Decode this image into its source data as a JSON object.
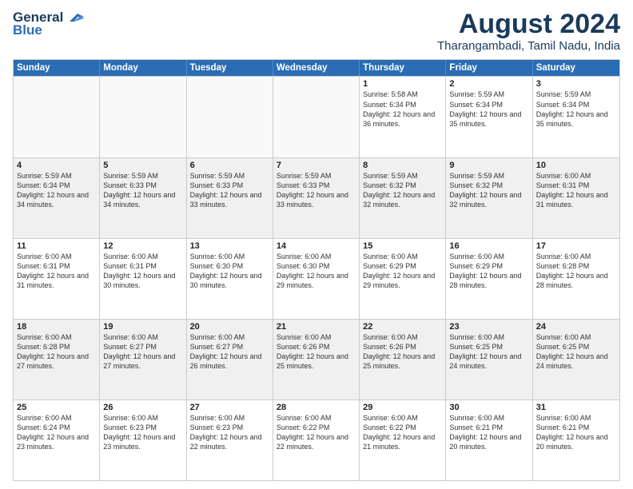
{
  "header": {
    "logo_line1": "General",
    "logo_line2": "Blue",
    "main_title": "August 2024",
    "subtitle": "Tharangambadi, Tamil Nadu, India"
  },
  "weekdays": [
    "Sunday",
    "Monday",
    "Tuesday",
    "Wednesday",
    "Thursday",
    "Friday",
    "Saturday"
  ],
  "weeks": [
    [
      {
        "day": "",
        "info": "",
        "empty": true
      },
      {
        "day": "",
        "info": "",
        "empty": true
      },
      {
        "day": "",
        "info": "",
        "empty": true
      },
      {
        "day": "",
        "info": "",
        "empty": true
      },
      {
        "day": "1",
        "info": "Sunrise: 5:58 AM\nSunset: 6:34 PM\nDaylight: 12 hours\nand 36 minutes.",
        "empty": false
      },
      {
        "day": "2",
        "info": "Sunrise: 5:59 AM\nSunset: 6:34 PM\nDaylight: 12 hours\nand 35 minutes.",
        "empty": false
      },
      {
        "day": "3",
        "info": "Sunrise: 5:59 AM\nSunset: 6:34 PM\nDaylight: 12 hours\nand 35 minutes.",
        "empty": false
      }
    ],
    [
      {
        "day": "4",
        "info": "Sunrise: 5:59 AM\nSunset: 6:34 PM\nDaylight: 12 hours\nand 34 minutes.",
        "empty": false
      },
      {
        "day": "5",
        "info": "Sunrise: 5:59 AM\nSunset: 6:33 PM\nDaylight: 12 hours\nand 34 minutes.",
        "empty": false
      },
      {
        "day": "6",
        "info": "Sunrise: 5:59 AM\nSunset: 6:33 PM\nDaylight: 12 hours\nand 33 minutes.",
        "empty": false
      },
      {
        "day": "7",
        "info": "Sunrise: 5:59 AM\nSunset: 6:33 PM\nDaylight: 12 hours\nand 33 minutes.",
        "empty": false
      },
      {
        "day": "8",
        "info": "Sunrise: 5:59 AM\nSunset: 6:32 PM\nDaylight: 12 hours\nand 32 minutes.",
        "empty": false
      },
      {
        "day": "9",
        "info": "Sunrise: 5:59 AM\nSunset: 6:32 PM\nDaylight: 12 hours\nand 32 minutes.",
        "empty": false
      },
      {
        "day": "10",
        "info": "Sunrise: 6:00 AM\nSunset: 6:31 PM\nDaylight: 12 hours\nand 31 minutes.",
        "empty": false
      }
    ],
    [
      {
        "day": "11",
        "info": "Sunrise: 6:00 AM\nSunset: 6:31 PM\nDaylight: 12 hours\nand 31 minutes.",
        "empty": false
      },
      {
        "day": "12",
        "info": "Sunrise: 6:00 AM\nSunset: 6:31 PM\nDaylight: 12 hours\nand 30 minutes.",
        "empty": false
      },
      {
        "day": "13",
        "info": "Sunrise: 6:00 AM\nSunset: 6:30 PM\nDaylight: 12 hours\nand 30 minutes.",
        "empty": false
      },
      {
        "day": "14",
        "info": "Sunrise: 6:00 AM\nSunset: 6:30 PM\nDaylight: 12 hours\nand 29 minutes.",
        "empty": false
      },
      {
        "day": "15",
        "info": "Sunrise: 6:00 AM\nSunset: 6:29 PM\nDaylight: 12 hours\nand 29 minutes.",
        "empty": false
      },
      {
        "day": "16",
        "info": "Sunrise: 6:00 AM\nSunset: 6:29 PM\nDaylight: 12 hours\nand 28 minutes.",
        "empty": false
      },
      {
        "day": "17",
        "info": "Sunrise: 6:00 AM\nSunset: 6:28 PM\nDaylight: 12 hours\nand 28 minutes.",
        "empty": false
      }
    ],
    [
      {
        "day": "18",
        "info": "Sunrise: 6:00 AM\nSunset: 6:28 PM\nDaylight: 12 hours\nand 27 minutes.",
        "empty": false
      },
      {
        "day": "19",
        "info": "Sunrise: 6:00 AM\nSunset: 6:27 PM\nDaylight: 12 hours\nand 27 minutes.",
        "empty": false
      },
      {
        "day": "20",
        "info": "Sunrise: 6:00 AM\nSunset: 6:27 PM\nDaylight: 12 hours\nand 26 minutes.",
        "empty": false
      },
      {
        "day": "21",
        "info": "Sunrise: 6:00 AM\nSunset: 6:26 PM\nDaylight: 12 hours\nand 25 minutes.",
        "empty": false
      },
      {
        "day": "22",
        "info": "Sunrise: 6:00 AM\nSunset: 6:26 PM\nDaylight: 12 hours\nand 25 minutes.",
        "empty": false
      },
      {
        "day": "23",
        "info": "Sunrise: 6:00 AM\nSunset: 6:25 PM\nDaylight: 12 hours\nand 24 minutes.",
        "empty": false
      },
      {
        "day": "24",
        "info": "Sunrise: 6:00 AM\nSunset: 6:25 PM\nDaylight: 12 hours\nand 24 minutes.",
        "empty": false
      }
    ],
    [
      {
        "day": "25",
        "info": "Sunrise: 6:00 AM\nSunset: 6:24 PM\nDaylight: 12 hours\nand 23 minutes.",
        "empty": false
      },
      {
        "day": "26",
        "info": "Sunrise: 6:00 AM\nSunset: 6:23 PM\nDaylight: 12 hours\nand 23 minutes.",
        "empty": false
      },
      {
        "day": "27",
        "info": "Sunrise: 6:00 AM\nSunset: 6:23 PM\nDaylight: 12 hours\nand 22 minutes.",
        "empty": false
      },
      {
        "day": "28",
        "info": "Sunrise: 6:00 AM\nSunset: 6:22 PM\nDaylight: 12 hours\nand 22 minutes.",
        "empty": false
      },
      {
        "day": "29",
        "info": "Sunrise: 6:00 AM\nSunset: 6:22 PM\nDaylight: 12 hours\nand 21 minutes.",
        "empty": false
      },
      {
        "day": "30",
        "info": "Sunrise: 6:00 AM\nSunset: 6:21 PM\nDaylight: 12 hours\nand 20 minutes.",
        "empty": false
      },
      {
        "day": "31",
        "info": "Sunrise: 6:00 AM\nSunset: 6:21 PM\nDaylight: 12 hours\nand 20 minutes.",
        "empty": false
      }
    ]
  ]
}
